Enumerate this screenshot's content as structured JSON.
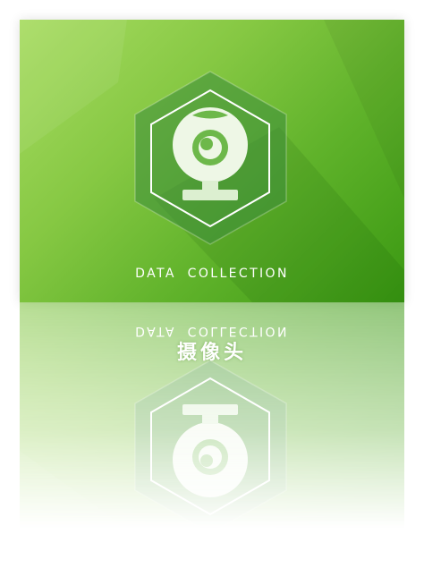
{
  "card": {
    "caption": "DATA COLLECTION",
    "title": "摄像头",
    "icon": "webcam-icon",
    "colors": {
      "gradient_start": "#a8dc62",
      "gradient_end": "#3a9812",
      "hex_fill": "#5aa83c"
    }
  }
}
